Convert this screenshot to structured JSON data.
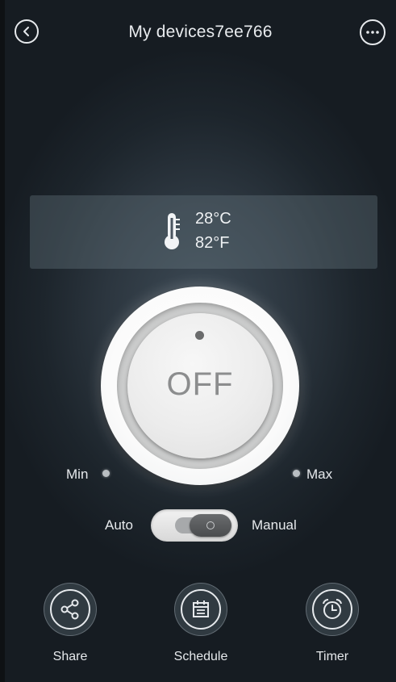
{
  "header": {
    "title": "My devices7ee766",
    "back_icon": "back-arrow-icon",
    "more_icon": "more-dots-icon"
  },
  "temperature": {
    "celsius": "28°C",
    "fahrenheit": "82°F",
    "icon": "thermometer-icon"
  },
  "power": {
    "label": "OFF",
    "state": "off"
  },
  "speed": {
    "min_label": "Min",
    "max_label": "Max"
  },
  "mode": {
    "auto_label": "Auto",
    "manual_label": "Manual",
    "selected": "Manual"
  },
  "actions": [
    {
      "label": "Share",
      "icon": "share-icon"
    },
    {
      "label": "Schedule",
      "icon": "calendar-icon"
    },
    {
      "label": "Timer",
      "icon": "alarm-clock-icon"
    }
  ],
  "colors": {
    "background": "#2c363f",
    "text": "#e6e9ec",
    "dial_text": "#8c8d8e"
  }
}
